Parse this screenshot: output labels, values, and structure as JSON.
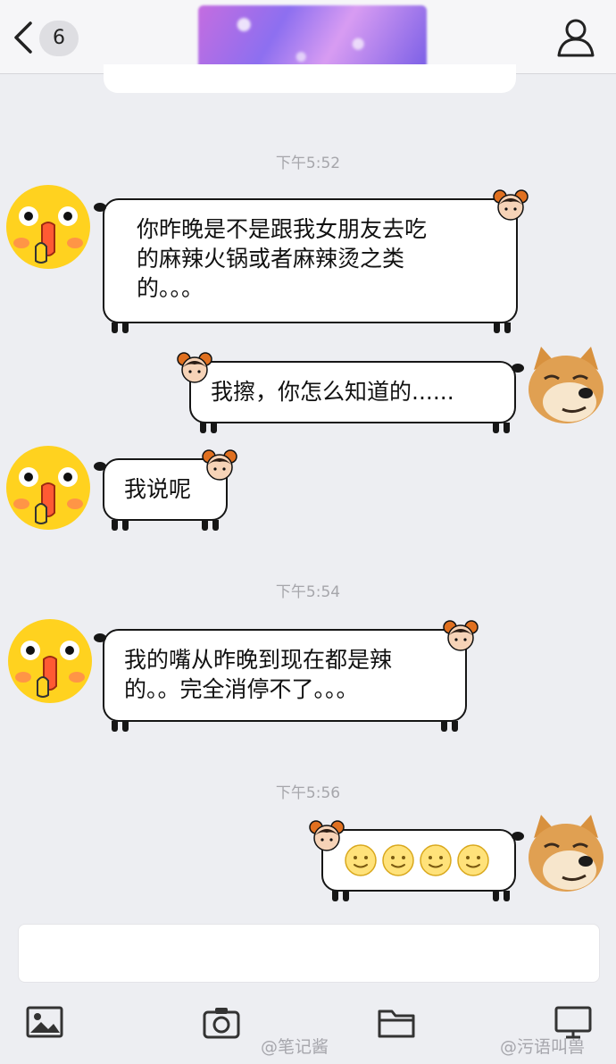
{
  "header": {
    "unread_count": "6"
  },
  "messages": [
    {
      "time": "下午5:52",
      "sender": "other",
      "text": "你昨晚是不是跟我女朋友去吃\n的麻辣火锅或者麻辣烫之类\n的。。。"
    },
    {
      "sender": "me",
      "text": "我擦，你怎么知道的......"
    },
    {
      "sender": "other",
      "text": "我说呢"
    },
    {
      "time": "下午5:54",
      "sender": "other",
      "text": "我的嘴从昨晚到现在都是辣\n的。。完全消停不了。。。"
    },
    {
      "time": "下午5:56",
      "sender": "me",
      "emoji": [
        "smile-face",
        "smile-face",
        "smile-face",
        "smile-face"
      ]
    }
  ],
  "colors": {
    "background": "#edeef2",
    "bubble_border": "#161616",
    "timestamp": "#a6a6ab",
    "emoji_yellow": "#ffd21f",
    "shiba": "#e0a052"
  },
  "toolbar": {
    "icons": [
      "image-icon",
      "camera-icon",
      "folder-icon",
      "screen-icon"
    ]
  },
  "watermarks": [
    "@笔记酱",
    "@污语叫兽"
  ]
}
